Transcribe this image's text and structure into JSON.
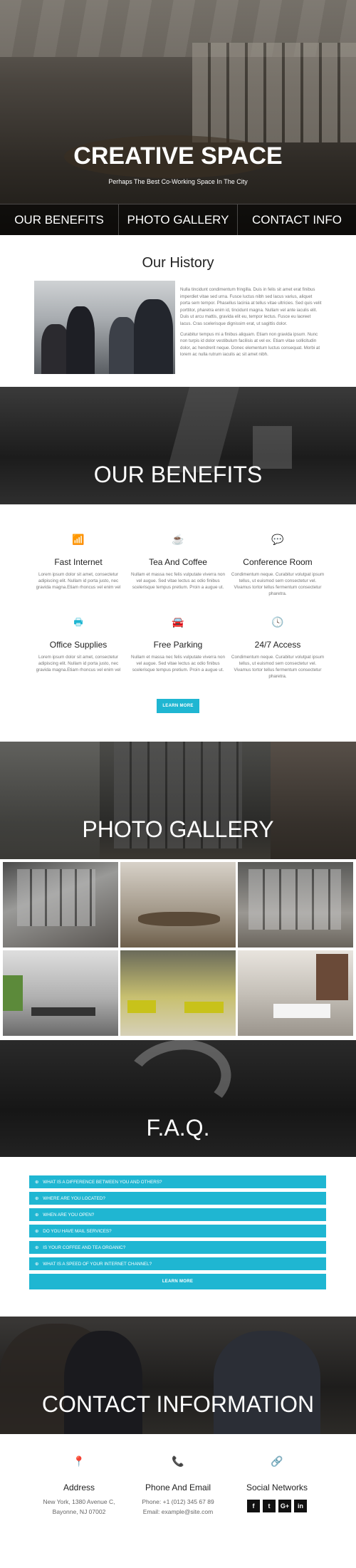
{
  "hero": {
    "title": "CREATIVE SPACE",
    "subtitle": "Perhaps The Best Co-Working Space In The City"
  },
  "nav": [
    "OUR BENEFITS",
    "PHOTO GALLERY",
    "CONTACT INFO"
  ],
  "history": {
    "title": "Our History",
    "paragraphs": [
      "Nulla tincidunt condimentum fringilla. Duis in felis sit amet erat finibus imperdiet vitae sed urna. Fusce luctus nibh sed lacus varius, aliquet porta sem tempor. Phasellus lacinia at tellus vitae ultricies. Sed quis velit porttitor, pharetra enim id, tincidunt magna. Nullam vel ante iaculis elit. Duis ut arcu mattis, gravida elit eu, tempor lectus. Fusce eu laoreet lacus. Cras scelerisque dignissim erat, ut sagittis dolor.",
      "Curabitur tempus mi a finibus aliquam. Etiam non gravida ipsum. Nunc non turpis id dolor vestibulum facilisis at vel ex. Etiam vitae sollicitudin dolor, ac hendrerit neque. Donec elementum luctus consequat. Morbi at lorem ac nulla rutrum iaculis ac sit amet nibh."
    ]
  },
  "benefits": {
    "title": "OUR BENEFITS",
    "items": [
      {
        "icon": "wifi-icon",
        "glyph": "📶",
        "title": "Fast Internet",
        "text": "Lorem ipsum dolor sit amet, consectetur adipiscing elit. Nullam id porta justo, nec gravida magna.Etiam rhoncus vel enim vel"
      },
      {
        "icon": "coffee-icon",
        "glyph": "☕",
        "title": "Tea And Coffee",
        "text": "Nullam et massa nec felis vulputate viverra non vel augue. Sed vitae lectus ac odio finibus scelerisque tempus pretium. Proin a augue ut."
      },
      {
        "icon": "chat-icon",
        "glyph": "💬",
        "title": "Conference Room",
        "text": "Condimentum neque. Curabitur volutpat ipsum tellus, ut euismod sem consectetur vel. Vivamus tortor tellus fermentum consectetur pharetra."
      },
      {
        "icon": "printer-icon",
        "glyph": "🖶",
        "title": "Office Supplies",
        "text": "Lorem ipsum dolor sit amet, consectetur adipiscing elit. Nullam id porta justo, nec gravida magna.Etiam rhoncus vel enim vel"
      },
      {
        "icon": "car-icon",
        "glyph": "🚘",
        "title": "Free Parking",
        "text": "Nullam et massa nec felis vulputate viverra non vel augue. Sed vitae lectus ac odio finibus scelerisque tempus pretium. Proin a augue ut."
      },
      {
        "icon": "clock-icon",
        "glyph": "🕓",
        "title": "24/7 Access",
        "text": "Condimentum neque. Curabitur volutpat ipsum tellus, ut euismod sem consectetur vel. Vivamus tortor tellus fermentum consectetur pharetra."
      }
    ],
    "button": "LEARN MORE"
  },
  "gallery": {
    "title": "PHOTO GALLERY"
  },
  "faq": {
    "title": "F.A.Q.",
    "questions": [
      "WHAT IS A DIFFERENCE BETWEEN YOU AND OTHERS?",
      "WHERE ARE YOU LOCATED?",
      "WHEN ARE YOU OPEN?",
      "DO YOU HAVE MAIL SERVICES?",
      "IS YOUR COFFEE AND TEA ORGANIC?",
      "WHAT IS A SPEED OF YOUR INTERNET CHANNEL?"
    ],
    "button": "LEARN MORE"
  },
  "contact": {
    "title": "CONTACT INFORMATION",
    "address": {
      "title": "Address",
      "line1": "New York, 1380 Avenue C,",
      "line2": "Bayonne, NJ 07002"
    },
    "phone": {
      "title": "Phone And Email",
      "line1": "Phone: +1 (012) 345 67 89",
      "line2": "Email: example@site.com"
    },
    "social": {
      "title": "Social Networks",
      "items": [
        "f",
        "t",
        "G+",
        "in"
      ]
    }
  },
  "colors": {
    "accent": "#1fb6d2"
  }
}
